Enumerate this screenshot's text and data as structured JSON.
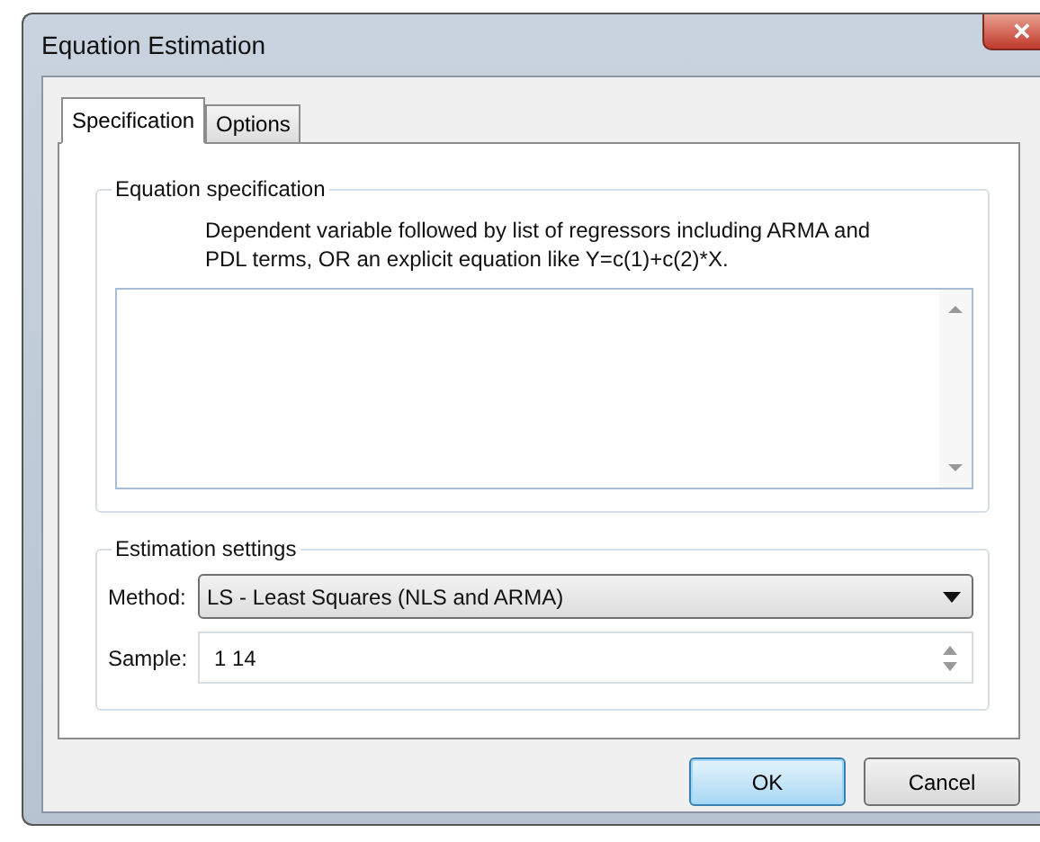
{
  "window": {
    "title": "Equation Estimation",
    "close": "✕"
  },
  "tabs": [
    {
      "label": "Specification",
      "selected": true
    },
    {
      "label": "Options",
      "selected": false
    }
  ],
  "equation_specification": {
    "title": "Equation specification",
    "hint": "Dependent variable followed by list of regressors including ARMA and PDL terms, OR an explicit equation like Y=c(1)+c(2)*X."
  },
  "estimation_settings": {
    "title": "Estimation settings",
    "method_label": "Method:",
    "method_value": "LS  -  Least Squares (NLS and ARMA)",
    "sample_label": "Sample:",
    "sample_value": "1 14"
  },
  "buttons": [
    {
      "label": "OK",
      "default": true
    },
    {
      "label": "Cancel",
      "default": false
    }
  ]
}
